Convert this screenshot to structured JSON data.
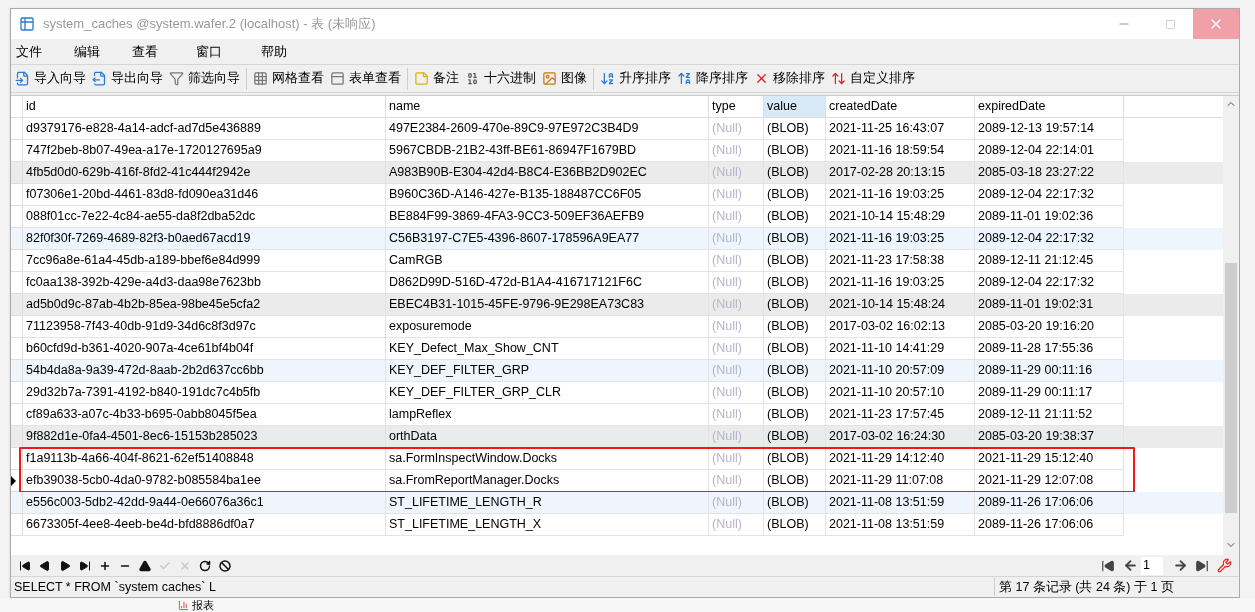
{
  "window": {
    "title": "system_caches @system.wafer.2 (localhost) - 表 (未响应)"
  },
  "menu": [
    "文件",
    "编辑",
    "查看",
    "窗口",
    "帮助"
  ],
  "toolbar_groups": [
    {
      "items": [
        "导入向导",
        "导出向导",
        "筛选向导"
      ]
    },
    {
      "items": [
        "网格查看",
        "表单查看"
      ]
    },
    {
      "items": [
        "备注",
        "十六进制",
        "图像"
      ]
    },
    {
      "items": [
        "升序排序",
        "降序排序",
        "移除排序",
        "自定义排序"
      ]
    }
  ],
  "table": {
    "columns": [
      {
        "label": "id",
        "selected": false
      },
      {
        "label": "name",
        "selected": false
      },
      {
        "label": "type",
        "selected": false
      },
      {
        "label": "value",
        "selected": true
      },
      {
        "label": "createdDate",
        "selected": false
      },
      {
        "label": "expiredDate",
        "selected": false
      }
    ],
    "rows": [
      {
        "color": "#ffffff",
        "current": false,
        "annotated": false,
        "cells": [
          "d9379176-e828-4a14-adcf-ad7d5e436889",
          "497E2384-2609-470e-89C9-97E972C3B4D9",
          "(Null)",
          "(BLOB)",
          "2021-11-25 16:43:07",
          "2089-12-13 19:57:14"
        ]
      },
      {
        "color": "#ffffff",
        "current": false,
        "annotated": false,
        "cells": [
          "747f2beb-8b07-49ea-a17e-1720127695a9",
          "5967CBDB-21B2-43ff-BE61-86947F1679BD",
          "(Null)",
          "(BLOB)",
          "2021-11-16 18:59:54",
          "2089-12-04 22:14:01"
        ]
      },
      {
        "color": "#ebebeb",
        "current": false,
        "annotated": false,
        "cells": [
          "4fb5d0d0-629b-416f-8fd2-41c444f2942e",
          "A983B90B-E304-42d4-B8C4-E36BB2D902EC",
          "(Null)",
          "(BLOB)",
          "2017-02-28 20:13:15",
          "2085-03-18 23:27:22"
        ]
      },
      {
        "color": "#ffffff",
        "current": false,
        "annotated": false,
        "cells": [
          "f07306e1-20bd-4461-83d8-fd090ea31d46",
          "B960C36D-A146-427e-B135-188487CC6F05",
          "(Null)",
          "(BLOB)",
          "2021-11-16 19:03:25",
          "2089-12-04 22:17:32"
        ]
      },
      {
        "color": "#ffffff",
        "current": false,
        "annotated": false,
        "cells": [
          "088f01cc-7e22-4c84-ae55-da8f2dba52dc",
          "BE884F99-3869-4FA3-9CC3-509EF36AEFB9",
          "(Null)",
          "(BLOB)",
          "2021-10-14 15:48:29",
          "2089-11-01 19:02:36"
        ]
      },
      {
        "color": "#eef5fd",
        "current": false,
        "annotated": false,
        "cells": [
          "82f0f30f-7269-4689-82f3-b0aed67acd19",
          "C56B3197-C7E5-4396-8607-178596A9EA77",
          "(Null)",
          "(BLOB)",
          "2021-11-16 19:03:25",
          "2089-12-04 22:17:32"
        ]
      },
      {
        "color": "#ffffff",
        "current": false,
        "annotated": false,
        "cells": [
          "7cc96a8e-61a4-45db-a189-bbef6e84d999",
          "CamRGB",
          "(Null)",
          "(BLOB)",
          "2021-11-23 17:58:38",
          "2089-12-11 21:12:45"
        ]
      },
      {
        "color": "#ffffff",
        "current": false,
        "annotated": false,
        "cells": [
          "fc0aa138-392b-429e-a4d3-daa98e7623bb",
          "D862D99D-516D-472d-B1A4-416717121F6C",
          "(Null)",
          "(BLOB)",
          "2021-11-16 19:03:25",
          "2089-12-04 22:17:32"
        ]
      },
      {
        "color": "#ebebeb",
        "current": false,
        "annotated": false,
        "cells": [
          "ad5b0d9c-87ab-4b2b-85ea-98be45e5cfa2",
          "EBEC4B31-1015-45FE-9796-9E298EA73C83",
          "(Null)",
          "(BLOB)",
          "2021-10-14 15:48:24",
          "2089-11-01 19:02:31"
        ]
      },
      {
        "color": "#ffffff",
        "current": false,
        "annotated": false,
        "cells": [
          "71123958-7f43-40db-91d9-34d6c8f3d97c",
          "exposuremode",
          "(Null)",
          "(BLOB)",
          "2017-03-02 16:02:13",
          "2085-03-20 19:16:20"
        ]
      },
      {
        "color": "#ffffff",
        "current": false,
        "annotated": false,
        "cells": [
          "b60cfd9d-b361-4020-907a-4ce61bf4b04f",
          "KEY_Defect_Max_Show_CNT",
          "(Null)",
          "(BLOB)",
          "2021-11-10 14:41:29",
          "2089-11-28 17:55:36"
        ]
      },
      {
        "color": "#eef5fd",
        "current": false,
        "annotated": false,
        "cells": [
          "54b4da8a-9a39-472d-8aab-2b2d637cc6bb",
          "KEY_DEF_FILTER_GRP",
          "(Null)",
          "(BLOB)",
          "2021-11-10 20:57:09",
          "2089-11-29 00:11:16"
        ]
      },
      {
        "color": "#ffffff",
        "current": false,
        "annotated": false,
        "cells": [
          "29d32b7a-7391-4192-b840-191dc7c4b5fb",
          "KEY_DEF_FILTER_GRP_CLR",
          "(Null)",
          "(BLOB)",
          "2021-11-10 20:57:10",
          "2089-11-29 00:11:17"
        ]
      },
      {
        "color": "#ffffff",
        "current": false,
        "annotated": false,
        "cells": [
          "cf89a633-a07c-4b33-b695-0abb8045f5ea",
          "lampReflex",
          "(Null)",
          "(BLOB)",
          "2021-11-23 17:57:45",
          "2089-12-11 21:11:52"
        ]
      },
      {
        "color": "#ebebeb",
        "current": false,
        "annotated": false,
        "cells": [
          "9f882d1e-0fa4-4501-8ec6-15153b285023",
          "orthData",
          "(Null)",
          "(BLOB)",
          "2017-03-02 16:24:30",
          "2085-03-20 19:38:37"
        ]
      },
      {
        "color": "#ffffff",
        "current": false,
        "annotated": true,
        "cells": [
          "f1a9113b-4a66-404f-8621-62ef51408848",
          "sa.FormInspectWindow.Docks",
          "(Null)",
          "(BLOB)",
          "2021-11-29 14:12:40",
          "2021-11-29 15:12:40"
        ]
      },
      {
        "color": "#ffffff",
        "current": true,
        "annotated": true,
        "cells": [
          "efb39038-5cb0-4da0-9782-b085584ba1ee",
          "sa.FromReportManager.Docks",
          "(Null)",
          "(BLOB)",
          "2021-11-29 11:07:08",
          "2021-11-29 12:07:08"
        ]
      },
      {
        "color": "#eef5fd",
        "current": false,
        "annotated": false,
        "cells": [
          "e556c003-5db2-42dd-9a44-0e66076a36c1",
          "ST_LIFETIME_LENGTH_R",
          "(Null)",
          "(BLOB)",
          "2021-11-08 13:51:59",
          "2089-11-26 17:06:06"
        ]
      },
      {
        "color": "#ffffff",
        "current": false,
        "annotated": false,
        "cells": [
          "6673305f-4ee8-4eeb-be4d-bfd8886df0a7",
          "ST_LIFETIME_LENGTH_X",
          "(Null)",
          "(BLOB)",
          "2021-11-08 13:51:59",
          "2089-11-26 17:06:06"
        ]
      }
    ]
  },
  "nav_buttons": [
    {
      "disabled": false
    },
    {
      "disabled": false
    },
    {
      "disabled": false
    },
    {
      "disabled": false
    },
    {
      "disabled": false
    },
    {
      "disabled": false
    },
    {
      "disabled": false
    },
    {
      "disabled": true
    },
    {
      "disabled": true
    },
    {
      "disabled": false
    },
    {
      "disabled": false
    }
  ],
  "pager": {
    "page": "1"
  },
  "status_bar": {
    "sql": "SELECT * FROM `system caches` L",
    "record": "第 17 条记录 (共 24 条) 于 1 页"
  },
  "background": {
    "label": "报表"
  }
}
